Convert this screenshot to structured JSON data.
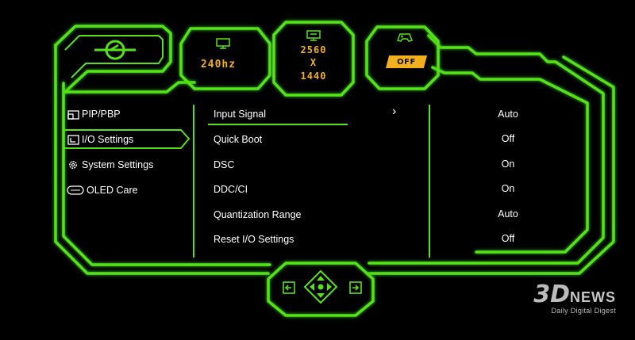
{
  "header": {
    "refresh_rate": "240hz",
    "resolution_width": "2560",
    "resolution_x": "X",
    "resolution_height": "1440",
    "game_mode": "OFF"
  },
  "sidebar": {
    "items": [
      {
        "label": "PIP/PBP",
        "icon": "pip-icon",
        "selected": false
      },
      {
        "label": "I/O Settings",
        "icon": "io-icon",
        "selected": true
      },
      {
        "label": "System Settings",
        "icon": "gear-icon",
        "selected": false
      },
      {
        "label": "OLED Care",
        "icon": "oled-icon",
        "selected": false
      }
    ]
  },
  "menu": {
    "rows": [
      {
        "label": "Input Signal",
        "value": "Auto",
        "selected": true
      },
      {
        "label": "Quick Boot",
        "value": "Off",
        "selected": false
      },
      {
        "label": "DSC",
        "value": "On",
        "selected": false
      },
      {
        "label": "DDC/CI",
        "value": "On",
        "selected": false
      },
      {
        "label": "Quantization Range",
        "value": "Auto",
        "selected": false
      },
      {
        "label": "Reset I/O Settings",
        "value": "Off",
        "selected": false
      }
    ],
    "chevron": "›"
  },
  "watermark": {
    "logo": "3D",
    "news": "NEWS",
    "tagline": "Daily Digital Digest"
  },
  "colors": {
    "frame": "#55e21a",
    "accent": "#f2b01e",
    "background": "#000000",
    "text": "#ffffff"
  }
}
